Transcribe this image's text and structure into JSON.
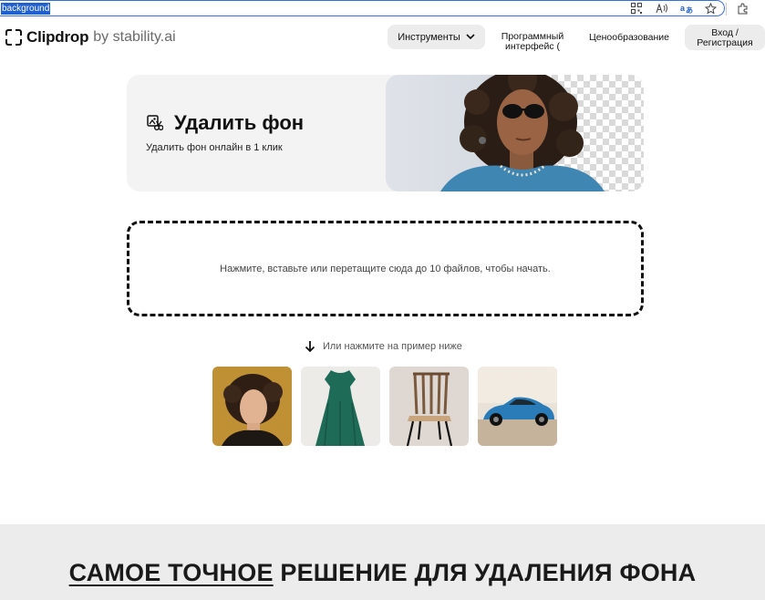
{
  "browser": {
    "url_text": "background",
    "icons": [
      "qr-code-icon",
      "read-aloud-icon",
      "translate-icon",
      "favorite-star-icon",
      "extensions-icon"
    ]
  },
  "header": {
    "logo_name": "Clipdrop",
    "logo_by": "by stability.ai",
    "nav": {
      "tools_label": "Инструменты",
      "api_line1": "Программный",
      "api_line2": "интерфейс (",
      "pricing_label": "Ценообразование",
      "login_line1": "Вход /",
      "login_line2": "Регистрация"
    }
  },
  "hero": {
    "title": "Удалить фон",
    "subtitle": "Удалить фон онлайн в 1 клик"
  },
  "dropzone": {
    "text": "Нажмите, вставьте или перетащите сюда до 10 файлов, чтобы начать."
  },
  "hint": {
    "text": "Или нажмите на пример ниже"
  },
  "samples": [
    "sample-portrait-woman",
    "sample-green-dress",
    "sample-chair",
    "sample-blue-car"
  ],
  "bottom": {
    "title_underlined": "САМОЕ ТОЧНОЕ",
    "title_rest": " РЕШЕНИЕ ДЛЯ УДАЛЕНИЯ ФОНА"
  },
  "colors": {
    "accent_url_highlight": "#1f5fce",
    "card_background": "#f3f3f4",
    "nav_pill": "#ececec"
  }
}
